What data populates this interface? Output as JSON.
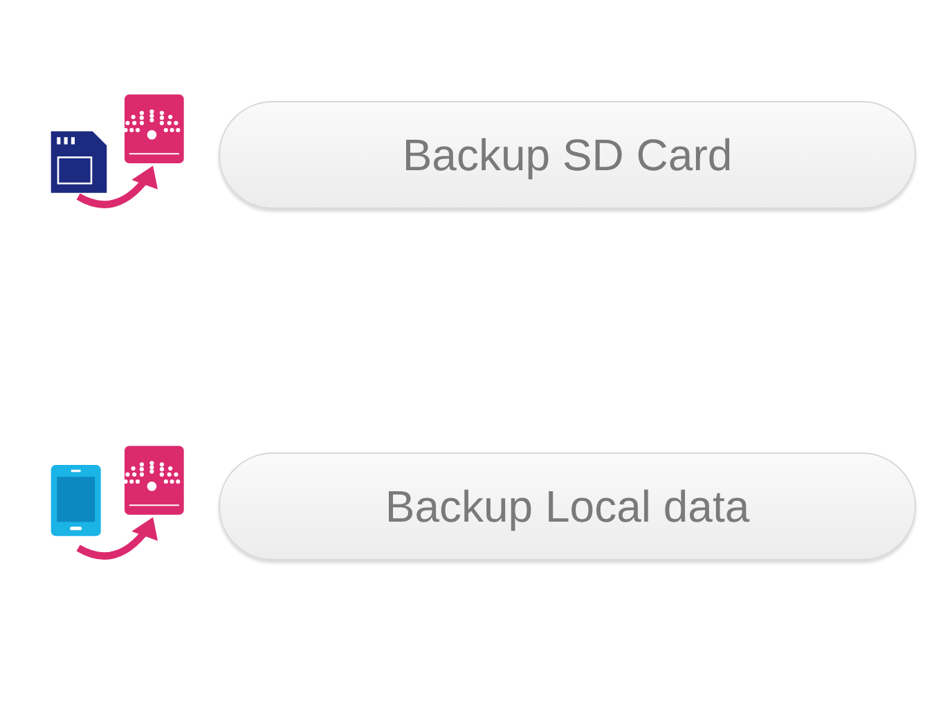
{
  "actions": [
    {
      "kind": "sd-card",
      "label": "Backup SD Card"
    },
    {
      "kind": "phone",
      "label": "Backup Local data"
    }
  ]
}
